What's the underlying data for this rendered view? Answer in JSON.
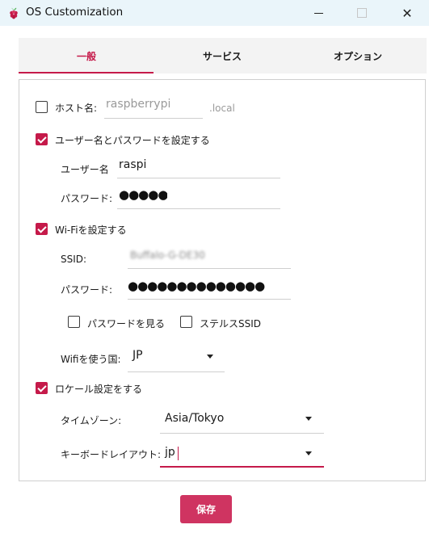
{
  "window": {
    "title": "OS Customization",
    "minimize_icon": "minimize-icon",
    "maximize_icon": "maximize-icon",
    "close_icon": "close-icon",
    "close_glyph": "✕",
    "app_icon": "raspberry-pi-icon"
  },
  "tabs": [
    {
      "label": "一般",
      "active": true
    },
    {
      "label": "サービス",
      "active": false
    },
    {
      "label": "オプション",
      "active": false
    }
  ],
  "accent_color": "#c51a4a",
  "general": {
    "hostname": {
      "label": "ホスト名:",
      "value": "raspberrypi",
      "suffix": ".local",
      "checked": false
    },
    "user": {
      "label": "ユーザー名とパスワードを設定する",
      "checked": true,
      "username_label": "ユーザー名",
      "username_value": "raspi",
      "password_label": "パスワード:",
      "password_value": "●●●●●"
    },
    "wifi": {
      "label": "Wi-Fiを設定する",
      "checked": true,
      "ssid_label": "SSID:",
      "ssid_value": "Buffalo-G-DE30",
      "password_label": "パスワード:",
      "password_value": "●●●●●●●●●●●●●●",
      "show_password_label": "パスワードを見る",
      "show_password_checked": false,
      "stealth_label": "ステルスSSID",
      "stealth_checked": false,
      "country_label": "Wifiを使う国:",
      "country_value": "JP"
    },
    "locale": {
      "label": "ロケール設定をする",
      "checked": true,
      "timezone_label": "タイムゾーン:",
      "timezone_value": "Asia/Tokyo",
      "keyboard_label": "キーボードレイアウト:",
      "keyboard_value": "jp"
    }
  },
  "save_label": "保存"
}
